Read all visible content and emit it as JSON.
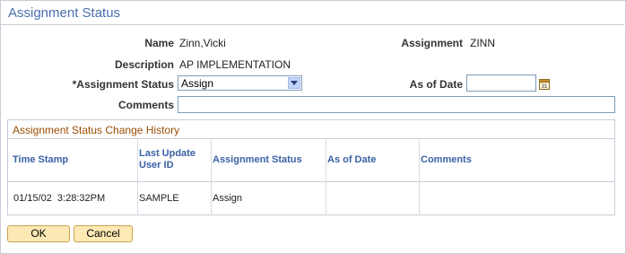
{
  "page": {
    "title": "Assignment Status"
  },
  "form": {
    "name_label": "Name",
    "name_value": "Zinn,Vicki",
    "assignment_label": "Assignment",
    "assignment_value": "ZINN",
    "description_label": "Description",
    "description_value": "AP IMPLEMENTATION",
    "status_label": "*Assignment Status",
    "status_value": "Assign",
    "as_of_date_label": "As of Date",
    "as_of_date_value": "",
    "comments_label": "Comments",
    "comments_value": ""
  },
  "history": {
    "title": "Assignment Status Change History",
    "columns": [
      "Time Stamp",
      "Last Update User ID",
      "Assignment Status",
      "As of Date",
      "Comments"
    ],
    "column_lines": [
      [
        "Time Stamp"
      ],
      [
        "Last Update",
        "User ID"
      ],
      [
        "Assignment Status"
      ],
      [
        "As of Date"
      ],
      [
        "Comments"
      ]
    ],
    "rows": [
      {
        "time_stamp": "01/15/02  3:28:32PM",
        "user_id": "SAMPLE",
        "status": "Assign",
        "as_of_date": "",
        "comments": ""
      }
    ]
  },
  "buttons": {
    "ok": "OK",
    "cancel": "Cancel"
  },
  "colors": {
    "title": "#4a6fae",
    "grid_title": "#9a4d00",
    "header": "#3a62a6",
    "button_bg": "#fde9b4"
  },
  "icons": {
    "dropdown": "chevron-down-icon",
    "calendar": "calendar-icon"
  }
}
